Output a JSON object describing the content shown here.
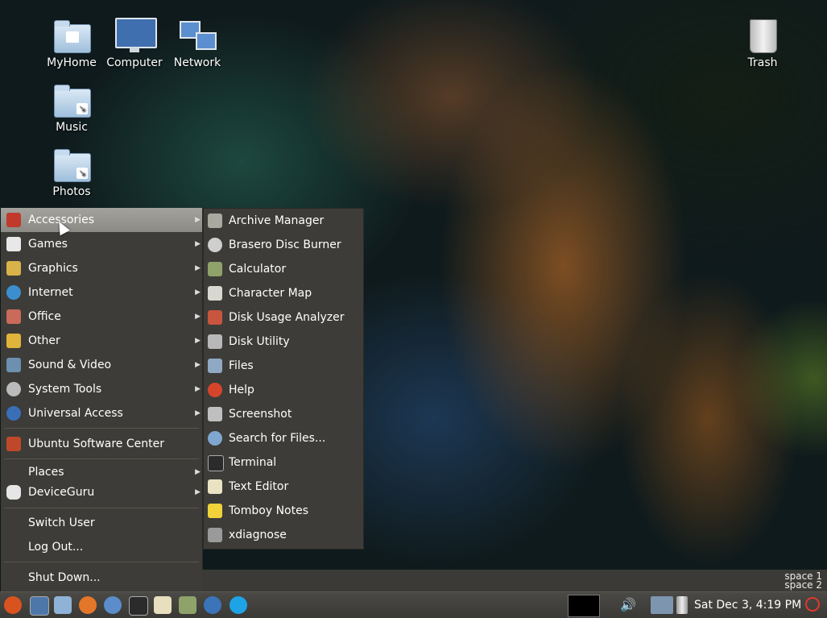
{
  "desktop": {
    "icons": {
      "myhome": "MyHome",
      "computer": "Computer",
      "network": "Network",
      "music": "Music",
      "photos": "Photos",
      "trash": "Trash"
    }
  },
  "menu": {
    "categories": [
      {
        "label": "Accessories",
        "icon": "accessories-icon",
        "has_submenu": true,
        "active": true
      },
      {
        "label": "Games",
        "icon": "games-icon",
        "has_submenu": true
      },
      {
        "label": "Graphics",
        "icon": "graphics-icon",
        "has_submenu": true
      },
      {
        "label": "Internet",
        "icon": "internet-icon",
        "has_submenu": true
      },
      {
        "label": "Office",
        "icon": "office-icon",
        "has_submenu": true
      },
      {
        "label": "Other",
        "icon": "other-icon",
        "has_submenu": true
      },
      {
        "label": "Sound & Video",
        "icon": "sound-video-icon",
        "has_submenu": true
      },
      {
        "label": "System Tools",
        "icon": "system-tools-icon",
        "has_submenu": true
      },
      {
        "label": "Universal Access",
        "icon": "universal-access-icon",
        "has_submenu": true
      }
    ],
    "software_center": "Ubuntu Software Center",
    "places": "Places",
    "deviceguru": "DeviceGuru",
    "switch_user": "Switch User",
    "log_out": "Log Out...",
    "shut_down": "Shut Down..."
  },
  "accessories_submenu": [
    {
      "label": "Archive Manager",
      "icon": "archive-manager-icon"
    },
    {
      "label": "Brasero Disc Burner",
      "icon": "disc-burner-icon"
    },
    {
      "label": "Calculator",
      "icon": "calculator-icon"
    },
    {
      "label": "Character Map",
      "icon": "character-map-icon"
    },
    {
      "label": "Disk Usage Analyzer",
      "icon": "disk-usage-icon"
    },
    {
      "label": "Disk Utility",
      "icon": "disk-utility-icon"
    },
    {
      "label": "Files",
      "icon": "files-icon"
    },
    {
      "label": "Help",
      "icon": "help-icon"
    },
    {
      "label": "Screenshot",
      "icon": "screenshot-icon"
    },
    {
      "label": "Search for Files...",
      "icon": "search-icon"
    },
    {
      "label": "Terminal",
      "icon": "terminal-icon"
    },
    {
      "label": "Text Editor",
      "icon": "text-editor-icon"
    },
    {
      "label": "Tomboy Notes",
      "icon": "tomboy-notes-icon"
    },
    {
      "label": "xdiagnose",
      "icon": "xdiagnose-icon"
    }
  ],
  "workspaces": {
    "space1": "space 1",
    "space2": "space 2"
  },
  "panel": {
    "clock": "Sat Dec  3,  4:19 PM"
  }
}
